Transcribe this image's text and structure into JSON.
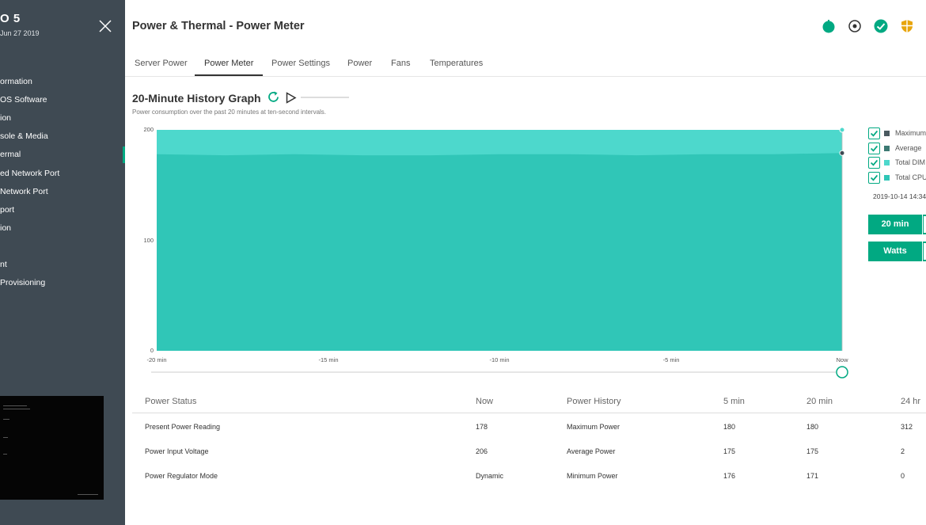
{
  "sidebar": {
    "title": "O 5",
    "subtitle": "Jun 27 2019",
    "items": [
      {
        "label": ""
      },
      {
        "label": "ormation"
      },
      {
        "label": "OS Software"
      },
      {
        "label": "ion"
      },
      {
        "label": "sole & Media"
      },
      {
        "label": "ermal",
        "active": true
      },
      {
        "label": "ed Network Port"
      },
      {
        "label": "Network Port"
      },
      {
        "label": "port"
      },
      {
        "label": "ion"
      },
      {
        "label": ""
      },
      {
        "label": "nt"
      },
      {
        "label": "Provisioning"
      }
    ]
  },
  "header": {
    "title": "Power & Thermal - Power Meter",
    "icons": [
      "power-icon",
      "target-icon",
      "check-circle-icon",
      "shield-icon"
    ]
  },
  "tabs": [
    {
      "label": "Server Power"
    },
    {
      "label": "Power Meter",
      "active": true
    },
    {
      "label": "Power Settings"
    },
    {
      "label": "Power"
    },
    {
      "label": "Fans"
    },
    {
      "label": "Temperatures"
    }
  ],
  "section": {
    "title": "20-Minute History Graph",
    "description": "Power consumption over the past 20 minutes at ten-second intervals."
  },
  "colors": {
    "accent": "#01a982",
    "sidebar": "#3f4a53",
    "maximum": "#4a5a60",
    "average": "#3c7a73",
    "dimm": "#4dd8cc",
    "cpu": "#30c6b7"
  },
  "chart_data": {
    "type": "area",
    "y_ticks": [
      "200",
      "100",
      "0"
    ],
    "x_ticks": [
      "-20 min",
      "-15 min",
      "-10 min",
      "-5 min",
      "Now"
    ],
    "ylim": [
      0,
      200
    ],
    "xlim": [
      -20,
      0
    ],
    "series": [
      {
        "name": "Maximum",
        "x": [
          -20,
          -15,
          -10,
          -5,
          0
        ],
        "values": [
          200,
          200,
          200,
          200,
          200
        ]
      },
      {
        "name": "Average",
        "x": [
          -20,
          -18,
          -16,
          -14,
          -12,
          -10,
          -8,
          -6,
          -4,
          -2,
          0
        ],
        "values": [
          178,
          177,
          178,
          177,
          177,
          178,
          178,
          177,
          178,
          178,
          179
        ]
      }
    ]
  },
  "legend": {
    "items": [
      {
        "label": "Maximum",
        "color": "#4a5a60"
      },
      {
        "label": "Average",
        "color": "#3c7a73"
      },
      {
        "label": "Total DIM",
        "color": "#4dd8cc"
      },
      {
        "label": "Total CPU",
        "color": "#30c6b7"
      }
    ],
    "timestamp": "2019-10-14 14:34"
  },
  "buttons": {
    "range": "20 min",
    "units": "Watts"
  },
  "table": {
    "headers": [
      "Power Status",
      "Now",
      "Power History",
      "5 min",
      "20 min",
      "24 hr"
    ],
    "rows": [
      [
        "Present Power Reading",
        "178",
        "Maximum Power",
        "180",
        "180",
        "312"
      ],
      [
        "Power Input Voltage",
        "206",
        "Average Power",
        "175",
        "175",
        "2"
      ],
      [
        "Power Regulator Mode",
        "Dynamic",
        "Minimum Power",
        "176",
        "171",
        "0"
      ]
    ]
  }
}
